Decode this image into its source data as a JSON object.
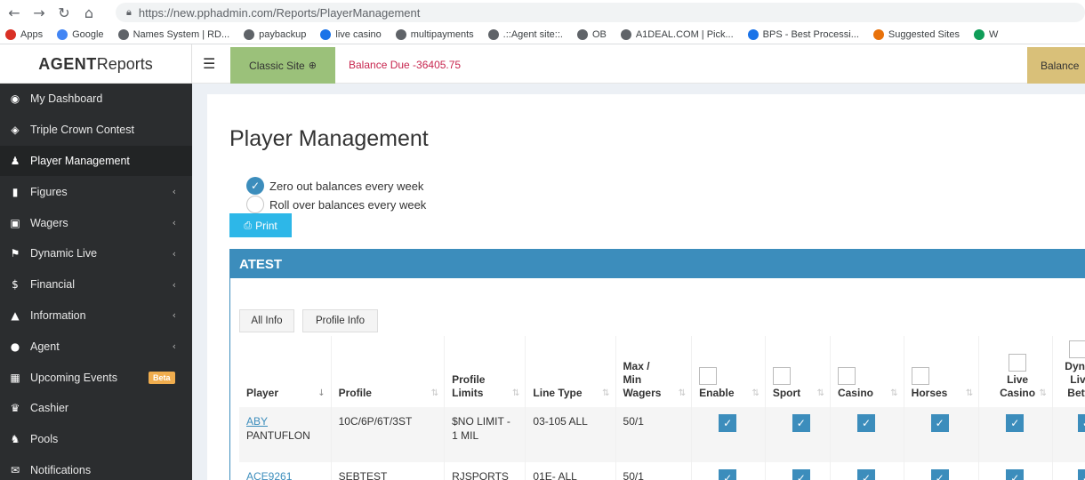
{
  "browser": {
    "url": "https://new.pphadmin.com/Reports/PlayerManagement",
    "bookmarks": [
      {
        "label": "Apps",
        "color": "#d93025"
      },
      {
        "label": "Google",
        "color": "#4285f4"
      },
      {
        "label": "Names System | RD...",
        "color": "#5f6368"
      },
      {
        "label": "paybackup",
        "color": "#5f6368"
      },
      {
        "label": "live casino",
        "color": "#1a73e8"
      },
      {
        "label": "multipayments",
        "color": "#5f6368"
      },
      {
        "label": ".::Agent site::.",
        "color": "#5f6368"
      },
      {
        "label": "OB",
        "color": "#5f6368"
      },
      {
        "label": "A1DEAL.COM | Pick...",
        "color": "#5f6368"
      },
      {
        "label": "BPS - Best Processi...",
        "color": "#1a73e8"
      },
      {
        "label": "Suggested Sites",
        "color": "#e8710a"
      },
      {
        "label": "W",
        "color": "#0f9d58"
      }
    ]
  },
  "header": {
    "logo_bold": "AGENT",
    "logo_rest": "Reports",
    "classic_site": "Classic Site",
    "balance_due": "Balance Due -36405.75",
    "balance_right": "Balance"
  },
  "sidebar": {
    "items": [
      {
        "label": "My Dashboard",
        "icon": "dashboard-icon",
        "glyph": "◉",
        "chevron": false
      },
      {
        "label": "Triple Crown Contest",
        "icon": "diamond-icon",
        "glyph": "◈",
        "chevron": false
      },
      {
        "label": "Player Management",
        "icon": "users-icon",
        "glyph": "♟",
        "chevron": false,
        "active": true
      },
      {
        "label": "Figures",
        "icon": "bar-chart-icon",
        "glyph": "▮",
        "chevron": true
      },
      {
        "label": "Wagers",
        "icon": "ticket-icon",
        "glyph": "▣",
        "chevron": true
      },
      {
        "label": "Dynamic Live",
        "icon": "flag-icon",
        "glyph": "⚑",
        "chevron": true
      },
      {
        "label": "Financial",
        "icon": "dollar-icon",
        "glyph": "$",
        "chevron": true
      },
      {
        "label": "Information",
        "icon": "warning-icon",
        "glyph": "▲",
        "chevron": true
      },
      {
        "label": "Agent",
        "icon": "user-icon",
        "glyph": "●",
        "chevron": true
      },
      {
        "label": "Upcoming Events",
        "icon": "calendar-icon",
        "glyph": "▦",
        "chevron": false,
        "badge": "Beta"
      },
      {
        "label": "Cashier",
        "icon": "trophy-icon",
        "glyph": "♛",
        "chevron": false
      },
      {
        "label": "Pools",
        "icon": "group-icon",
        "glyph": "♞",
        "chevron": false
      },
      {
        "label": "Notifications",
        "icon": "envelope-icon",
        "glyph": "✉",
        "chevron": false
      }
    ]
  },
  "main": {
    "title": "Player Management",
    "radio_zero": "Zero out balances every week",
    "radio_roll": "Roll over balances every week",
    "print_label": "Print",
    "panel_title": "ATEST",
    "tab_all": "All Info",
    "tab_profile": "Profile Info"
  },
  "table": {
    "headers": {
      "player": "Player",
      "profile": "Profile",
      "profile_limits_1": "Profile",
      "profile_limits_2": "Limits",
      "line_type": "Line Type",
      "max_min_1": "Max /",
      "max_min_2": "Min",
      "max_min_3": "Wagers",
      "enable": "Enable",
      "sport": "Sport",
      "casino": "Casino",
      "horses": "Horses",
      "live_casino_1": "Live",
      "live_casino_2": "Casino",
      "dynamic_1": "Dyna",
      "dynamic_2": "Liv",
      "dynamic_3": "Bett"
    },
    "rows": [
      {
        "player_id": "ABY",
        "player_name": "PANTUFLON",
        "profile": "10C/6P/6T/3ST",
        "limits_1": "$NO LIMIT -",
        "limits_2": "1 MIL",
        "line_type": "03-105 ALL",
        "max_min": "50/1"
      },
      {
        "player_id": "ACE9261",
        "player_name": "",
        "profile": "SEBTEST",
        "limits_1": "RJSPORTS",
        "limits_2": "",
        "line_type": "01E- ALL",
        "max_min": "50/1"
      }
    ]
  },
  "colors": {
    "accent": "#3c8dbc",
    "sidebar_bg": "#2b2d2f",
    "classic_bg": "#9bc17a",
    "balance_due": "#c7254e",
    "print_bg": "#2db7e8"
  }
}
